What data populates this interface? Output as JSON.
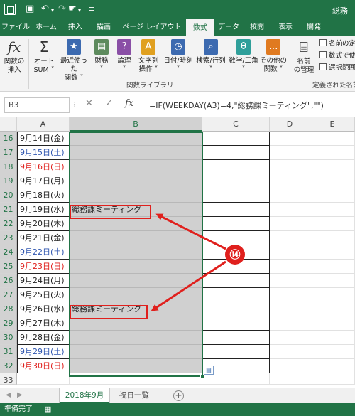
{
  "titlebar": {
    "title": "総務",
    "save_icon": "save-icon",
    "undo_icon": "undo-icon",
    "redo_icon": "redo-icon",
    "touch_icon": "touch-mode-icon",
    "customize_icon": "customize-icon"
  },
  "tabs": [
    {
      "label": "ファイル"
    },
    {
      "label": "ホーム"
    },
    {
      "label": "挿入"
    },
    {
      "label": "描画"
    },
    {
      "label": "ページ レイアウト"
    },
    {
      "label": "数式"
    },
    {
      "label": "データ"
    },
    {
      "label": "校閲"
    },
    {
      "label": "表示"
    },
    {
      "label": "開発"
    }
  ],
  "ribbon": {
    "buttons": [
      {
        "line1": "関数の",
        "line2": "挿入",
        "icon": "fx"
      },
      {
        "line1": "オート",
        "line2": "SUM ˅",
        "icon": "Σ"
      },
      {
        "line1": "最近使った",
        "line2": "関数 ˅",
        "icon": "★"
      },
      {
        "line1": "財務",
        "line2": "˅",
        "icon": "▤"
      },
      {
        "line1": "論理",
        "line2": "˅",
        "icon": "?"
      },
      {
        "line1": "文字列",
        "line2": "操作 ˅",
        "icon": "A"
      },
      {
        "line1": "日付/時刻",
        "line2": "˅",
        "icon": "◷"
      },
      {
        "line1": "検索/行列",
        "line2": "˅",
        "icon": "⌕"
      },
      {
        "line1": "数学/三角",
        "line2": "˅",
        "icon": "θ"
      },
      {
        "line1": "その他の",
        "line2": "関数 ˅",
        "icon": "…"
      },
      {
        "line1": "名前",
        "line2": "の管理",
        "icon": "⌸"
      }
    ],
    "group_label_functions": "関数ライブラリ",
    "group_label_names": "定義された名前",
    "small_items": [
      "名前の定",
      "数式で使",
      "選択範囲"
    ]
  },
  "formula_bar": {
    "name_box": "B3",
    "cancel": "✕",
    "enter": "✓",
    "fx": "fx",
    "formula": "=IF(WEEKDAY(A3)=4,\"総務課ミーティング\",\"\")"
  },
  "columns": [
    "A",
    "B",
    "C",
    "D",
    "E"
  ],
  "rows": [
    {
      "num": "16",
      "date": "9月14日(金)",
      "b": ""
    },
    {
      "num": "17",
      "date": "9月15日(土)",
      "b": ""
    },
    {
      "num": "18",
      "date": "9月16日(日)",
      "b": ""
    },
    {
      "num": "19",
      "date": "9月17日(月)",
      "b": ""
    },
    {
      "num": "20",
      "date": "9月18日(火)",
      "b": ""
    },
    {
      "num": "21",
      "date": "9月19日(水)",
      "b": "総務課ミーティング"
    },
    {
      "num": "22",
      "date": "9月20日(木)",
      "b": ""
    },
    {
      "num": "23",
      "date": "9月21日(金)",
      "b": ""
    },
    {
      "num": "24",
      "date": "9月22日(土)",
      "b": ""
    },
    {
      "num": "25",
      "date": "9月23日(日)",
      "b": ""
    },
    {
      "num": "26",
      "date": "9月24日(月)",
      "b": ""
    },
    {
      "num": "27",
      "date": "9月25日(火)",
      "b": ""
    },
    {
      "num": "28",
      "date": "9月26日(水)",
      "b": "総務課ミーティング"
    },
    {
      "num": "29",
      "date": "9月27日(木)",
      "b": ""
    },
    {
      "num": "30",
      "date": "9月28日(金)",
      "b": ""
    },
    {
      "num": "31",
      "date": "9月29日(土)",
      "b": ""
    },
    {
      "num": "32",
      "date": "9月30日(日)",
      "b": ""
    },
    {
      "num": "33",
      "date": "",
      "b": ""
    }
  ],
  "annotation": {
    "label": "⑭"
  },
  "sheets": [
    {
      "label": "2018年9月"
    },
    {
      "label": "祝日一覧"
    }
  ],
  "status": {
    "text": "準備完了"
  },
  "colors": {
    "excel_green": "#217346",
    "saturday_blue": "#2f56b0",
    "sunday_red": "#e0201d",
    "annotation_red": "#e0201d",
    "selection_gray": "#d0d0d0"
  }
}
